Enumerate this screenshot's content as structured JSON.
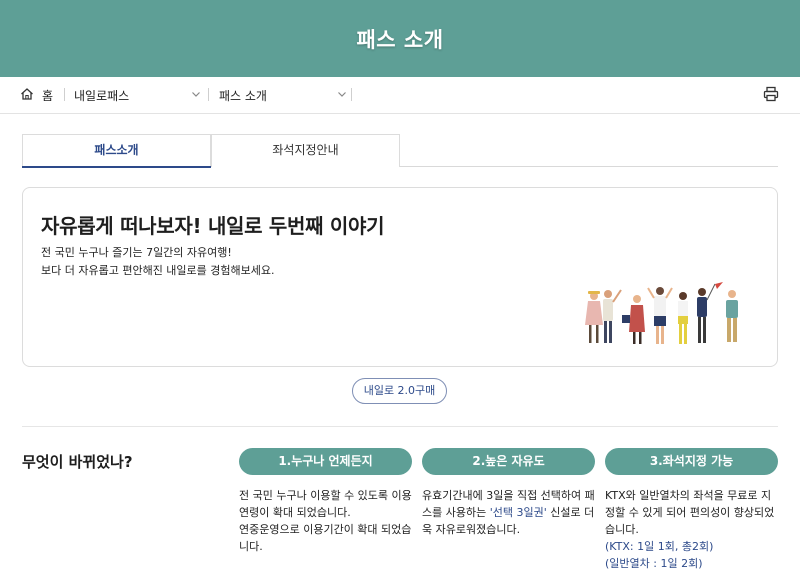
{
  "header": {
    "title": "패스 소개"
  },
  "breadcrumb": {
    "home": "홈",
    "level1": "내일로패스",
    "level2": "패스 소개"
  },
  "tabs": [
    {
      "label": "패스소개",
      "active": true
    },
    {
      "label": "좌석지정안내",
      "active": false
    }
  ],
  "intro": {
    "title": "자유롭게 떠나보자! 내일로 두번째 이야기",
    "line1": "전 국민 누구나 즐기는 7일간의 자유여행!",
    "line2": "보다 더 자유롭고 편안해진 내일로를 경험해보세요."
  },
  "buy_button": "내일로 2.0구매",
  "what_changed": {
    "title": "무엇이 바뀌었나?",
    "features": [
      {
        "label": "1.누구나 언제든지",
        "text_a": "전 국민 누구나 이용할 수 있도록 이용 연령이 확대 되었습니다.",
        "text_b": "연중운영으로 이용기간이 확대 되었습니다."
      },
      {
        "label": "2.높은 자유도",
        "text_pre": "유효기간내에 3일을 직접 선택하여 패스를 사용하는 ",
        "text_highlight": "'선택 3일권'",
        "text_post": " 신설로 더욱 자유로워졌습니다."
      },
      {
        "label": "3.좌석지정 가능",
        "text_a": "KTX와 일반열차의 좌석을 무료로 지정할 수 있게 되어 편의성이 향상되었습니다.",
        "note1": "(KTX: 1일 1회, 총2회)",
        "note2": "(일반열차 : 1일 2회)"
      }
    ]
  },
  "colors": {
    "header_bg": "#5e9f96",
    "accent_blue": "#2d4a8a",
    "pill_bg": "#5e9f96"
  },
  "icons": [
    "home-icon",
    "chevron-down-icon",
    "print-icon"
  ]
}
